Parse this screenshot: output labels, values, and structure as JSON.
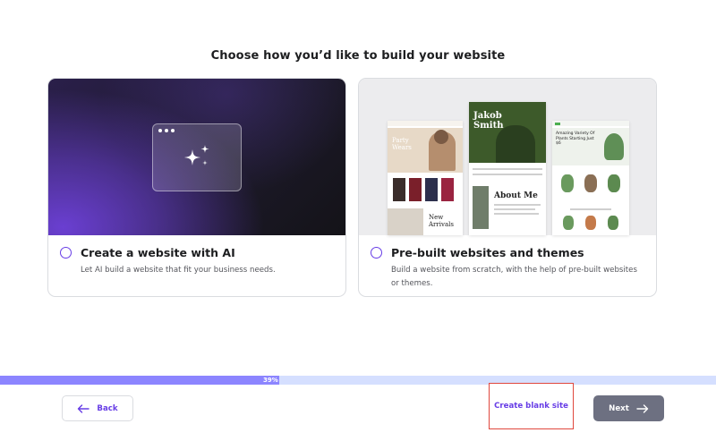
{
  "page_title": "Choose how you’d like to build your website",
  "options": [
    {
      "title": "Create a website with AI",
      "description": "Let AI build a website that fit your business needs."
    },
    {
      "title": "Pre-built websites and themes",
      "description": "Build a website from scratch, with the help of pre-built websites or themes."
    }
  ],
  "theme_preview": {
    "left_heading": "Party Wears",
    "left_sub": "New Arrivals",
    "mid_heading": "Jakob Smith",
    "mid_about": "About Me",
    "right_heading": "Amazing Variety Of Plants Starting Just $6"
  },
  "progress": {
    "percent": 39,
    "label": "39%"
  },
  "footer": {
    "back_label": "Back",
    "blank_label": "Create blank site",
    "next_label": "Next"
  },
  "colors": {
    "accent": "#673de6",
    "progress_fill": "#8c85ff",
    "progress_track": "#d5dfff",
    "next_bg": "#6d7081",
    "highlight_border": "#e0473d"
  },
  "icons": {
    "ai_card": "sparkles-icon",
    "back": "arrow-left-icon",
    "next": "arrow-right-icon"
  }
}
